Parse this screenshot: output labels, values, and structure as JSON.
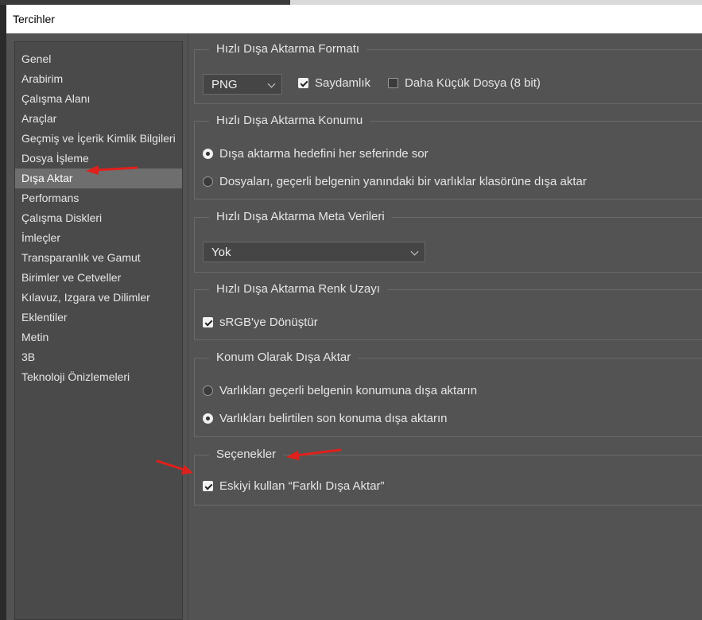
{
  "window": {
    "title": "Tercihler"
  },
  "sidebar": {
    "items": [
      {
        "label": "Genel"
      },
      {
        "label": "Arabirim"
      },
      {
        "label": "Çalışma Alanı"
      },
      {
        "label": "Araçlar"
      },
      {
        "label": "Geçmiş ve İçerik Kimlik Bilgileri"
      },
      {
        "label": "Dosya İşleme"
      },
      {
        "label": "Dışa Aktar",
        "selected": true
      },
      {
        "label": "Performans"
      },
      {
        "label": "Çalışma Diskleri"
      },
      {
        "label": "İmleçler"
      },
      {
        "label": "Transparanlık ve Gamut"
      },
      {
        "label": "Birimler ve Cetveller"
      },
      {
        "label": "Kılavuz, Izgara ve Dilimler"
      },
      {
        "label": "Eklentiler"
      },
      {
        "label": "Metin"
      },
      {
        "label": "3B"
      },
      {
        "label": "Teknoloji Önizlemeleri"
      }
    ]
  },
  "quick_export_format": {
    "legend": "Hızlı Dışa Aktarma Formatı",
    "format_value": "PNG",
    "transparency_label": "Saydamlık",
    "transparency_checked": true,
    "smaller_file_label": "Daha Küçük Dosya (8 bit)",
    "smaller_file_checked": false
  },
  "quick_export_location": {
    "legend": "Hızlı Dışa Aktarma Konumu",
    "option_ask": "Dışa aktarma hedefini her seferinde sor",
    "option_assets_folder": "Dosyaları, geçerli belgenin yanındaki bir varlıklar klasörüne dışa aktar",
    "selected": "ask"
  },
  "quick_export_metadata": {
    "legend": "Hızlı Dışa Aktarma Meta Verileri",
    "value": "Yok"
  },
  "quick_export_color_space": {
    "legend": "Hızlı Dışa Aktarma Renk Uzayı",
    "convert_srgb_label": "sRGB'ye Dönüştür",
    "convert_srgb_checked": true
  },
  "export_as": {
    "legend": "Konum Olarak Dışa Aktar",
    "option_current_doc": "Varlıkları geçerli belgenin konumuna dışa aktarın",
    "option_last_location": "Varlıkları belirtilen son konuma dışa aktarın",
    "selected": "last_location"
  },
  "options": {
    "legend": "Seçenekler",
    "legacy_label": "Eskiyi kullan “Farklı Dışa Aktar”",
    "legacy_checked": true
  },
  "colors": {
    "annotation_arrow": "#e0201b",
    "panel_bg": "#535353",
    "sidebar_bg": "#4a4a4a",
    "selected_bg": "#6e6e6e"
  }
}
